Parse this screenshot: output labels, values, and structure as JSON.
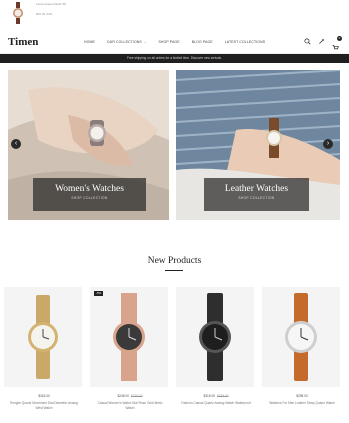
{
  "cart_preview": {
    "product_name": "Lorem Ipsum Dolor Sit",
    "price": "$00.00 USD"
  },
  "header": {
    "logo": "Timen",
    "nav": [
      {
        "label": "HOME",
        "has_dropdown": false
      },
      {
        "label": "OUR COLLECTIONS",
        "has_dropdown": true
      },
      {
        "label": "SHOP PAGE",
        "has_dropdown": false
      },
      {
        "label": "BLOG PAGE",
        "has_dropdown": false
      },
      {
        "label": "LATEST COLLECTIONS",
        "has_dropdown": false
      }
    ],
    "icons": [
      "search-icon",
      "wishlist-icon",
      "cart-icon"
    ],
    "cart_count": "0"
  },
  "announcement": "Free shipping on all orders for a limited time. Discover new arrivals.",
  "slides": [
    {
      "title": "Women's Watches",
      "subtitle": "SHOP COLLECTION"
    },
    {
      "title": "Leather Watches",
      "subtitle": "SHOP COLLECTION"
    }
  ],
  "section_title": "New Products",
  "products": [
    {
      "price": "$315.00",
      "old_price": "",
      "name": "Ronglei Quartz Movement Dial Diameter Analog Wrist Watch",
      "badge": "",
      "strap_color": "#c9a86a",
      "dial_color": "#f5f3ee",
      "case_color": "#d4b270"
    },
    {
      "price": "$248.00",
      "old_price": "$275.00",
      "name": "Casual Women's Watch Dial Rose Gold Mesh Watch",
      "badge": "-5%",
      "strap_color": "#d9a48c",
      "dial_color": "#3a3a3a",
      "case_color": "#d9a48c"
    },
    {
      "price": "$315.00",
      "old_price": "$335.00",
      "name": "Fashion Casual Quartz Analog Watch Waterproof",
      "badge": "",
      "strap_color": "#2e2e2e",
      "dial_color": "#1e1e1e",
      "case_color": "#555555"
    },
    {
      "price": "$298.00",
      "old_price": "",
      "name": "Watches For Men Leather Strap Quartz Watch",
      "badge": "",
      "strap_color": "#c46a2a",
      "dial_color": "#f6f6f6",
      "case_color": "#cfcfcf"
    }
  ],
  "colors": {
    "announcement_bg": "#1f1f1f",
    "caption_bg": "#282828",
    "text_dark": "#222222"
  }
}
